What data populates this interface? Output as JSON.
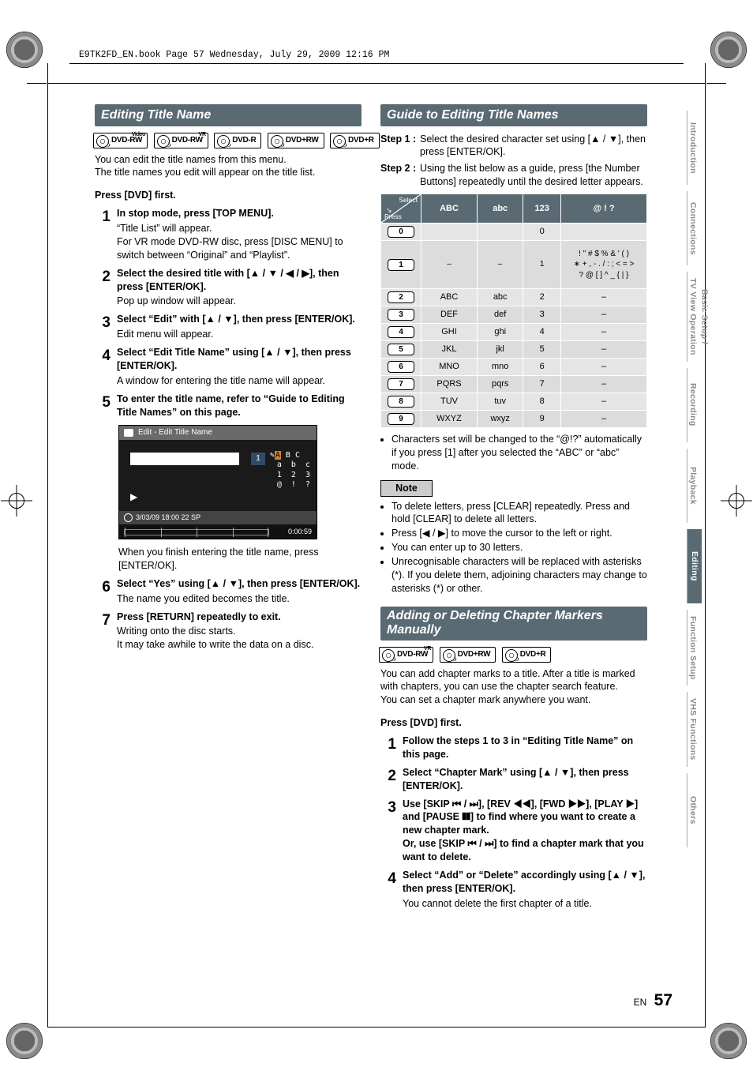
{
  "header_note": "E9TK2FD_EN.book  Page 57  Wednesday, July 29, 2009  12:16 PM",
  "page_label_lang": "EN",
  "page_number": "57",
  "left": {
    "heading": "Editing Title Name",
    "disc_labels": [
      "DVD-RW",
      "DVD-RW",
      "DVD-R",
      "DVD+RW",
      "DVD+R"
    ],
    "disc_sup": [
      "Video",
      "VR",
      "",
      "",
      ""
    ],
    "intro1": "You can edit the title names from this menu.",
    "intro2": "The title names you edit will appear on the title list.",
    "precond": "Press [DVD] first.",
    "steps": [
      {
        "n": "1",
        "bold": "In stop mode, press [TOP MENU].",
        "body": "“Title List” will appear.\nFor VR mode DVD-RW disc, press [DISC MENU] to switch between “Original” and “Playlist”."
      },
      {
        "n": "2",
        "bold": "Select the desired title with [▲ / ▼ / ◀ / ▶], then press [ENTER/OK].",
        "body": "Pop up window will appear."
      },
      {
        "n": "3",
        "bold": "Select “Edit” with [▲ / ▼], then press [ENTER/OK].",
        "body": "Edit menu will appear."
      },
      {
        "n": "4",
        "bold": "Select “Edit Title Name” using [▲ / ▼], then press [ENTER/OK].",
        "body": "A window for entering the title name will appear."
      },
      {
        "n": "5",
        "bold": "To enter the title name, refer to “Guide to Editing Title Names” on this page.",
        "body": ""
      }
    ],
    "figure": {
      "title": "Edit - Edit Title Name",
      "num": "1",
      "chars_line1a": "A",
      "chars_line1b": " B C",
      "chars_line2": "a  b  c",
      "chars_line3": "1  2  3",
      "chars_line4": "@  !  ?",
      "status": "3/03/09  18:00  22  SP",
      "time": "0:00:59"
    },
    "after_fig": "When you finish entering the title name, press [ENTER/OK].",
    "steps2": [
      {
        "n": "6",
        "bold": "Select “Yes” using [▲ / ▼], then press [ENTER/OK].",
        "body": "The name you edited becomes the title."
      },
      {
        "n": "7",
        "bold": "Press [RETURN] repeatedly to exit.",
        "body": "Writing onto the disc starts.\nIt may take awhile to write the data on a disc."
      }
    ]
  },
  "right": {
    "heading1": "Guide to Editing Title Names",
    "gsteps": [
      {
        "lab": "Step 1",
        "body": "Select the desired character set using [▲ / ▼], then press [ENTER/OK]."
      },
      {
        "lab": "Step 2",
        "body": "Using the list below as a guide, press [the Number Buttons] repeatedly until the desired letter appears."
      }
    ],
    "table": {
      "diag_a": "Select",
      "diag_b": "Press",
      "heads": [
        "ABC",
        "abc",
        "123",
        "@ ! ?"
      ],
      "rows": [
        {
          "key": "0",
          "cells": [
            "<space>",
            "<space>",
            "0",
            "<space>"
          ]
        },
        {
          "key": "1",
          "cells": [
            "–",
            "–",
            "1",
            "! \" # $ % & ' ( )\n∗ + , - . / : ; < = >\n? @ [ ] ^ _ { | }"
          ]
        },
        {
          "key": "2",
          "cells": [
            "ABC",
            "abc",
            "2",
            "–"
          ]
        },
        {
          "key": "3",
          "cells": [
            "DEF",
            "def",
            "3",
            "–"
          ]
        },
        {
          "key": "4",
          "cells": [
            "GHI",
            "ghi",
            "4",
            "–"
          ]
        },
        {
          "key": "5",
          "cells": [
            "JKL",
            "jkl",
            "5",
            "–"
          ]
        },
        {
          "key": "6",
          "cells": [
            "MNO",
            "mno",
            "6",
            "–"
          ]
        },
        {
          "key": "7",
          "cells": [
            "PQRS",
            "pqrs",
            "7",
            "–"
          ]
        },
        {
          "key": "8",
          "cells": [
            "TUV",
            "tuv",
            "8",
            "–"
          ]
        },
        {
          "key": "9",
          "cells": [
            "WXYZ",
            "wxyz",
            "9",
            "–"
          ]
        }
      ]
    },
    "after_table": "Characters set will be changed to the “@!?” automatically if you press [1] after you selected the “ABC” or “abc” mode.",
    "note_label": "Note",
    "notes": [
      "To delete letters, press [CLEAR] repeatedly. Press and hold [CLEAR] to delete all letters.",
      "Press [◀ / ▶] to move the cursor to the left or right.",
      "You can enter up to 30 letters.",
      "Unrecognisable characters will be replaced with asterisks (*). If you delete them, adjoining characters may change to asterisks (*) or other."
    ],
    "heading2": "Adding or Deleting Chapter Markers Manually",
    "disc_labels2": [
      "DVD-RW",
      "DVD+RW",
      "DVD+R"
    ],
    "disc_sup2": [
      "VR",
      "",
      ""
    ],
    "chap_intro": "You can add chapter marks to a title. After a title is marked with chapters, you can use the chapter search feature.\nYou can set a chapter mark anywhere you want.",
    "chap_pre": "Press [DVD] first.",
    "chap_steps": [
      {
        "n": "1",
        "bold": "Follow the steps 1 to 3 in “Editing Title Name” on this page.",
        "body": ""
      },
      {
        "n": "2",
        "bold": "Select “Chapter Mark” using [▲ / ▼], then press [ENTER/OK].",
        "body": ""
      },
      {
        "n": "3",
        "bold": "Use [SKIP ⏮ / ⏭], [REV ◀◀], [FWD ▶▶], [PLAY ▶] and [PAUSE ❚❚] to find where you want to create a new chapter mark.\nOr, use [SKIP ⏮ / ⏭] to find a chapter mark that you want to delete.",
        "body": ""
      },
      {
        "n": "4",
        "bold": "Select “Add” or “Delete” accordingly using [▲ / ▼], then press [ENTER/OK].",
        "body": "You cannot delete the first chapter of a title."
      }
    ]
  },
  "tabs": [
    "Introduction",
    "Connections",
    "Basic Setup /\nTV View Operation",
    "Recording",
    "Playback",
    "Editing",
    "Function Setup",
    "VHS Functions",
    "Others"
  ],
  "active_tab": 5
}
